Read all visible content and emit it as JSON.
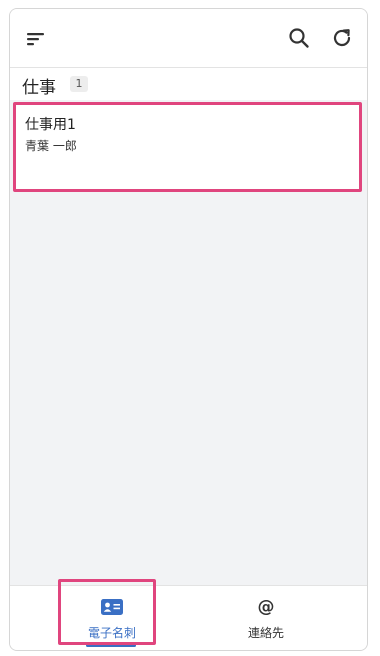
{
  "header": {
    "menu_icon": "menu-icon",
    "search_icon": "search-icon",
    "refresh_icon": "refresh-icon"
  },
  "section": {
    "title": "仕事",
    "count": "1"
  },
  "cards": [
    {
      "title": "仕事用1",
      "subtitle": "青葉 一郎"
    }
  ],
  "bottom_nav": {
    "items": [
      {
        "label": "電子名刺",
        "icon": "business-card-icon",
        "active": true
      },
      {
        "label": "連絡先",
        "icon": "at-sign-icon",
        "active": false
      }
    ]
  },
  "colors": {
    "accent": "#3a6fc4",
    "highlight": "#e0457e",
    "background": "#f2f3f5"
  }
}
